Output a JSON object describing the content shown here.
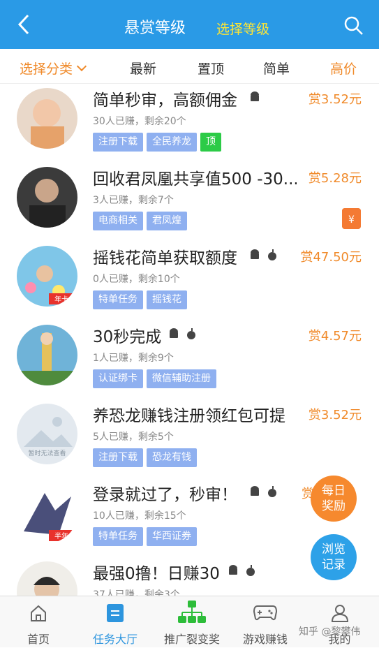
{
  "header": {
    "title": "悬赏等级",
    "select_level": "选择等级"
  },
  "filters": {
    "category": "选择分类",
    "newest": "最新",
    "pinned": "置顶",
    "simple": "简单",
    "high_price": "高价"
  },
  "tasks": [
    {
      "title": "简单秒审，高额佣金",
      "reward": "赏3.52元",
      "meta": "30人已赚，剩余20个",
      "tags": [
        "注册下载",
        "全民养龙",
        "顶"
      ],
      "os": [
        "android"
      ]
    },
    {
      "title": "回收君凤凰共享值500 -30...",
      "reward": "赏5.28元",
      "meta": "3人已赚，剩余7个",
      "tags": [
        "电商相关",
        "君凤煌"
      ],
      "os": []
    },
    {
      "title": "摇钱花简单获取额度",
      "reward": "赏47.50元",
      "meta": "0人已赚，剩余10个",
      "tags": [
        "特单任务",
        "摇钱花"
      ],
      "os": [
        "android",
        "apple"
      ],
      "avatar_badge": "年卡"
    },
    {
      "title": "30秒完成",
      "reward": "赏4.57元",
      "meta": "1人已赚，剩余9个",
      "tags": [
        "认证绑卡",
        "微信辅助注册"
      ],
      "os": [
        "android",
        "apple"
      ]
    },
    {
      "title": "养恐龙赚钱注册领红包可提",
      "reward": "赏3.52元",
      "meta": "5人已赚，剩余5个",
      "tags": [
        "注册下载",
        "恐龙有钱"
      ],
      "os": [],
      "avatar_text": "暂时无法查看"
    },
    {
      "title": "登录就过了，秒审！",
      "reward": "赏",
      "meta": "10人已赚，剩余15个",
      "tags": [
        "特单任务",
        "华西证券"
      ],
      "os": [
        "android",
        "apple"
      ],
      "avatar_badge": "半年"
    },
    {
      "title": "最强0撸！日赚30",
      "reward": "",
      "meta": "37人已赚，剩余3个",
      "tags": [],
      "os": [
        "android",
        "apple"
      ]
    }
  ],
  "floats": {
    "daily": "每日奖励",
    "history": "浏览记录"
  },
  "bottom_nav": [
    "首页",
    "任务大厅",
    "推广裂变奖",
    "游戏赚钱",
    "我的"
  ],
  "watermark": "知乎 @黎攀伟",
  "colors": {
    "header": "#2a9ae6",
    "accent": "#f08a2a",
    "tag": "#8fb0f0",
    "active": "#2d95de"
  }
}
